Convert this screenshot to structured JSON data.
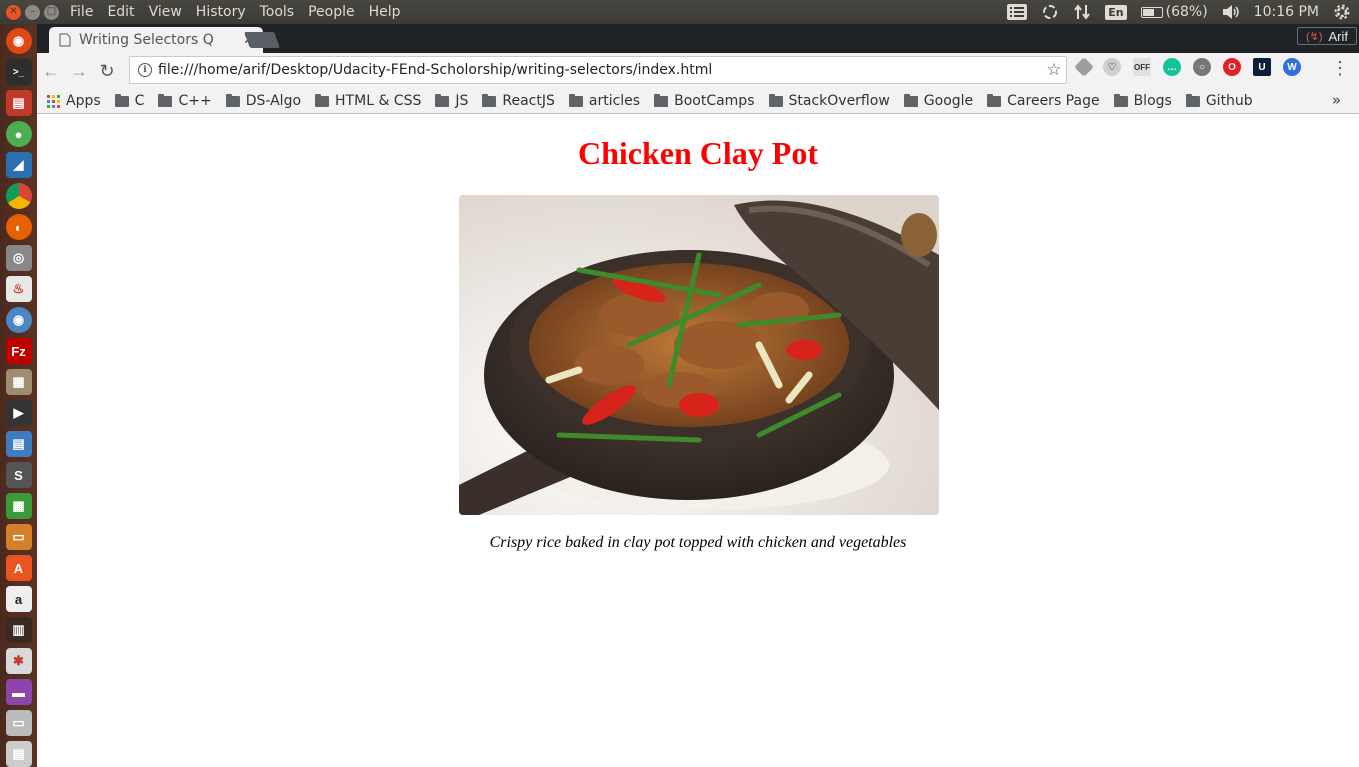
{
  "system_panel": {
    "menu": [
      "File",
      "Edit",
      "View",
      "History",
      "Tools",
      "People",
      "Help"
    ],
    "keyboard_layout": "En",
    "battery": "(68%)",
    "battery_level": 0.68,
    "time": "10:16 PM"
  },
  "browser": {
    "tab_title": "Writing Selectors Q",
    "profile_name": "Arif",
    "url": "file:///home/arif/Desktop/Udacity-FEnd-Scholorship/writing-selectors/index.html",
    "bookmarks": [
      "Apps",
      "C",
      "C++",
      "DS-Algo",
      "HTML & CSS",
      "JS",
      "ReactJS",
      "articles",
      "BootCamps",
      "StackOverflow",
      "Google",
      "Careers Page",
      "Blogs",
      "Github"
    ]
  },
  "page": {
    "title": "Chicken Clay Pot",
    "caption": "Crispy rice baked in clay pot topped with chicken and vegetables",
    "title_color": "#ff0000"
  },
  "colors": {
    "ubuntu_orange": "#e95420",
    "launcher_bg": "#5a3323",
    "panel_bg": "#3c3b37"
  }
}
